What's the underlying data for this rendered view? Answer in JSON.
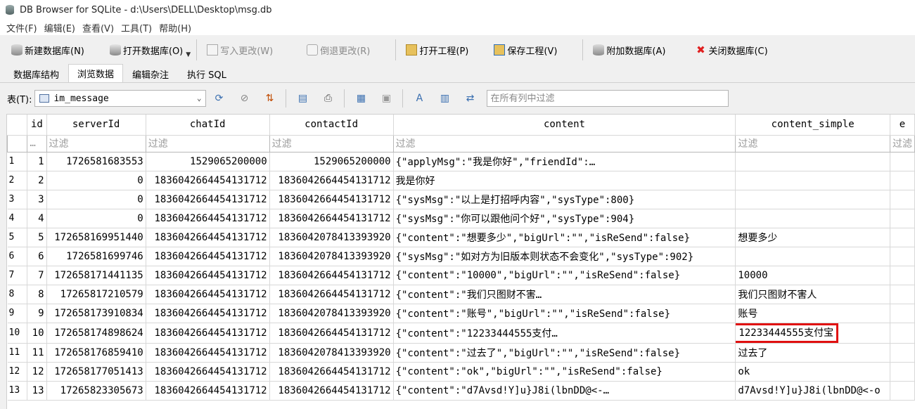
{
  "window": {
    "title": "DB Browser for SQLite - d:\\Users\\DELL\\Desktop\\msg.db"
  },
  "menu": [
    "文件(F)",
    "编辑(E)",
    "查看(V)",
    "工具(T)",
    "帮助(H)"
  ],
  "toolbar": {
    "new_db": "新建数据库(N)",
    "open_db": "打开数据库(O)",
    "write_changes": "写入更改(W)",
    "revert_changes": "倒退更改(R)",
    "open_project": "打开工程(P)",
    "save_project": "保存工程(V)",
    "attach_db": "附加数据库(A)",
    "close_db": "关闭数据库(C)"
  },
  "tabs": [
    "数据库结构",
    "浏览数据",
    "编辑杂注",
    "执行 SQL"
  ],
  "active_tab": "浏览数据",
  "browse": {
    "table_label": "表(T):",
    "table_name": "im_message",
    "global_filter_placeholder": "在所有列中过滤",
    "filter_placeholder": "过滤"
  },
  "grid": {
    "columns": [
      "id",
      "serverId",
      "chatId",
      "contactId",
      "content",
      "content_simple",
      "e"
    ],
    "rows": [
      [
        "1",
        "1726581683553",
        "1529065200000",
        "1529065200000",
        "{\"applyMsg\":\"我是你好\",\"friendId\":…",
        ""
      ],
      [
        "2",
        "0",
        "1836042664454131712",
        "1836042664454131712",
        "我是你好",
        ""
      ],
      [
        "3",
        "0",
        "1836042664454131712",
        "1836042664454131712",
        "{\"sysMsg\":\"以上是打招呼内容\",\"sysType\":800}",
        ""
      ],
      [
        "4",
        "0",
        "1836042664454131712",
        "1836042664454131712",
        "{\"sysMsg\":\"你可以跟他问个好\",\"sysType\":904}",
        ""
      ],
      [
        "5",
        "172658169951440",
        "1836042664454131712",
        "1836042078413393920",
        "{\"content\":\"想要多少\",\"bigUrl\":\"\",\"isReSend\":false}",
        "想要多少"
      ],
      [
        "6",
        "1726581699746",
        "1836042664454131712",
        "1836042078413393920",
        "{\"sysMsg\":\"如对方为旧版本则状态不会变化\",\"sysType\":902}",
        ""
      ],
      [
        "7",
        "172658171441135",
        "1836042664454131712",
        "1836042664454131712",
        "{\"content\":\"10000\",\"bigUrl\":\"\",\"isReSend\":false}",
        "10000"
      ],
      [
        "8",
        "17265817210579",
        "1836042664454131712",
        "1836042664454131712",
        "{\"content\":\"我们只图财不害…",
        "我们只图财不害人"
      ],
      [
        "9",
        "172658173910834",
        "1836042664454131712",
        "1836042078413393920",
        "{\"content\":\"账号\",\"bigUrl\":\"\",\"isReSend\":false}",
        "账号"
      ],
      [
        "10",
        "172658174898624",
        "1836042664454131712",
        "1836042664454131712",
        "{\"content\":\"12233444555支付…",
        "12233444555支付宝"
      ],
      [
        "11",
        "172658176859410",
        "1836042664454131712",
        "1836042078413393920",
        "{\"content\":\"过去了\",\"bigUrl\":\"\",\"isReSend\":false}",
        "过去了"
      ],
      [
        "12",
        "172658177051413",
        "1836042664454131712",
        "1836042664454131712",
        "{\"content\":\"ok\",\"bigUrl\":\"\",\"isReSend\":false}",
        "ok"
      ],
      [
        "13",
        "17265823305673",
        "1836042664454131712",
        "1836042664454131712",
        "{\"content\":\"d7Avsd!Y]u}J8i(lbnDD@<-…",
        "d7Avsd!Y]u}J8i(lbnDD@<-o"
      ]
    ],
    "highlighted_row": 10,
    "highlight_color": "#e01010"
  }
}
